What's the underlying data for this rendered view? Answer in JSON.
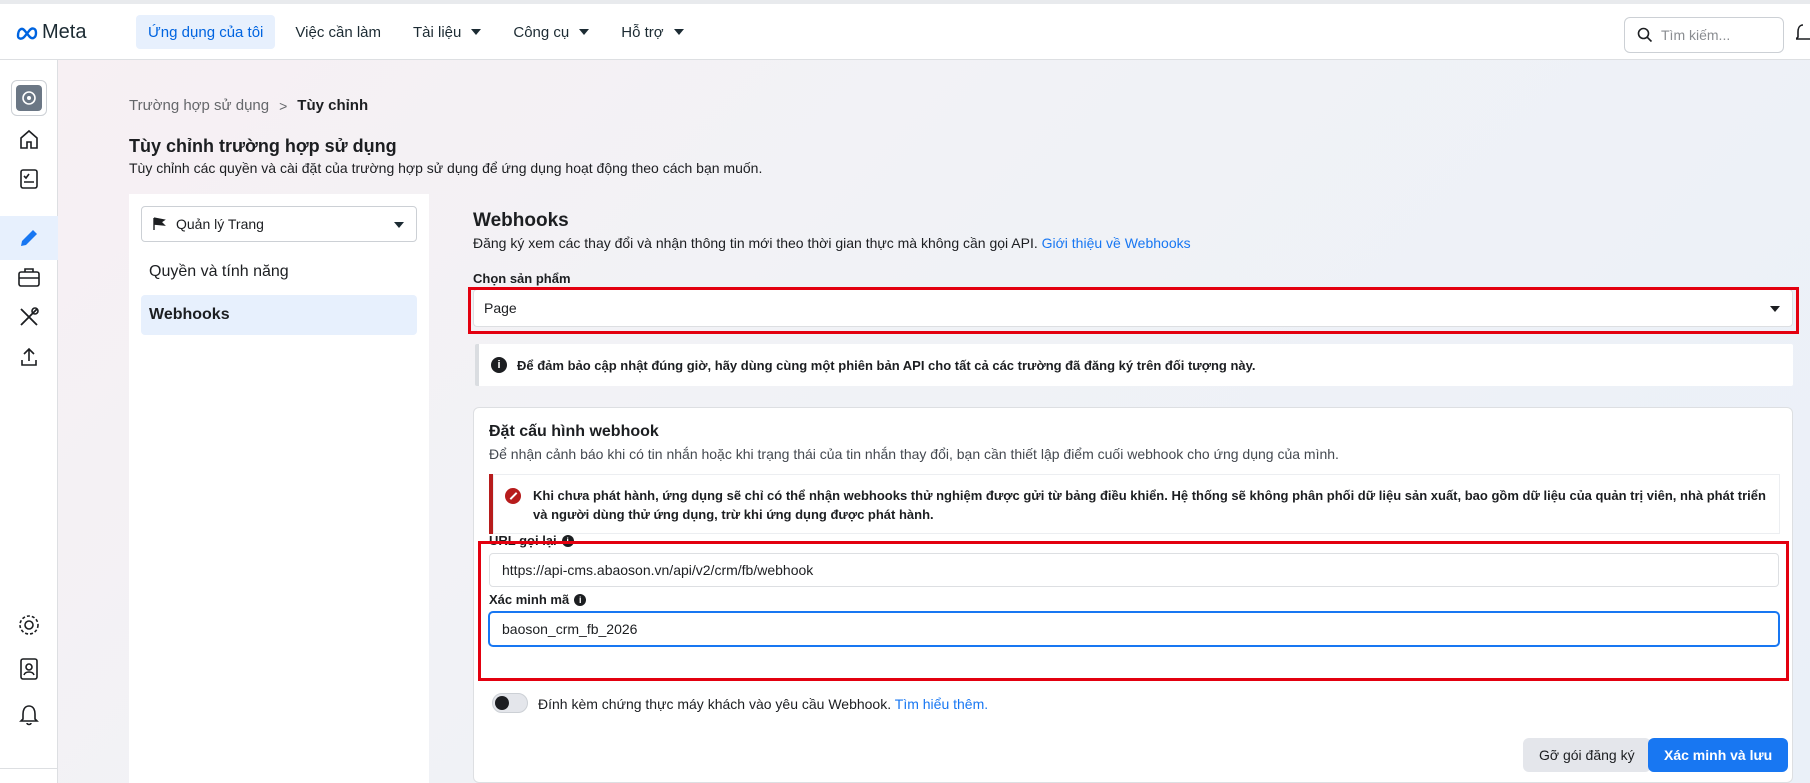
{
  "topbar": {
    "logo": "Meta",
    "nav": [
      {
        "label": "Ứng dụng của tôi",
        "active": true,
        "has_caret": false
      },
      {
        "label": "Việc cần làm",
        "active": false,
        "has_caret": false
      },
      {
        "label": "Tài liệu",
        "active": false,
        "has_caret": true
      },
      {
        "label": "Công cụ",
        "active": false,
        "has_caret": true
      },
      {
        "label": "Hỗ trợ",
        "active": false,
        "has_caret": true
      }
    ],
    "search_placeholder": "Tìm kiếm..."
  },
  "rail": {
    "icons": [
      "app-icon",
      "home-icon",
      "checklist-icon",
      "edit-icon",
      "briefcase-icon",
      "tools-icon",
      "upload-icon",
      "settings-icon",
      "contacts-icon",
      "bell-icon"
    ],
    "active": "edit-icon"
  },
  "breadcrumb": {
    "parent": "Trường hợp sử dụng",
    "separator": ">",
    "current": "Tùy chỉnh"
  },
  "page": {
    "title": "Tùy chỉnh trường hợp sử dụng",
    "subtitle": "Tùy chỉnh các quyền và cài đặt của trường hợp sử dụng để ứng dụng hoạt động theo cách bạn muốn."
  },
  "left_panel": {
    "product": "Quản lý Trang",
    "items": [
      {
        "label": "Quyền và tính năng",
        "active": false
      },
      {
        "label": "Webhooks",
        "active": true
      }
    ]
  },
  "webhooks": {
    "title": "Webhooks",
    "description": "Đăng ký xem các thay đổi và nhận thông tin mới theo thời gian thực mà không cần gọi API.",
    "description_link": "Giới thiệu về Webhooks",
    "product_label": "Chọn sản phẩm",
    "product_value": "Page",
    "notice": "Để đảm bảo cập nhật đúng giờ, hãy dùng cùng một phiên bản API cho tất cả các trường đã đăng ký trên đối tượng này."
  },
  "config": {
    "title": "Đặt cấu hình webhook",
    "subtitle": "Để nhận cảnh báo khi có tin nhắn hoặc khi trạng thái của tin nhắn thay đổi, bạn cần thiết lập điểm cuối webhook cho ứng dụng của mình.",
    "warning_line1": "Khi chưa phát hành, ứng dụng sẽ chỉ có thể nhận webhooks thử nghiệm được gửi từ bảng điều khiển. Hệ thống sẽ không phân phối dữ liệu sản xuất, bao gồm dữ liệu của quản trị viên, nhà phát triển",
    "warning_line2": "và người dùng thử ứng dụng, trừ khi ứng dụng được phát hành.",
    "callback_label": "URL gọi lại",
    "callback_value": "https://api-cms.abaoson.vn/api/v2/crm/fb/webhook",
    "verify_label": "Xác minh mã",
    "verify_value": "baoson_crm_fb_2026",
    "toggle_text": "Đính kèm chứng thực máy khách vào yêu cầu Webhook.",
    "toggle_link": "Tìm hiểu thêm.",
    "toggle_on": false,
    "unsubscribe_button": "Gỡ gói đăng ký",
    "save_button": "Xác minh và lưu"
  },
  "colors": {
    "accent": "#1877f2",
    "highlight_box": "#e3000f",
    "warning": "#b71c1c"
  }
}
